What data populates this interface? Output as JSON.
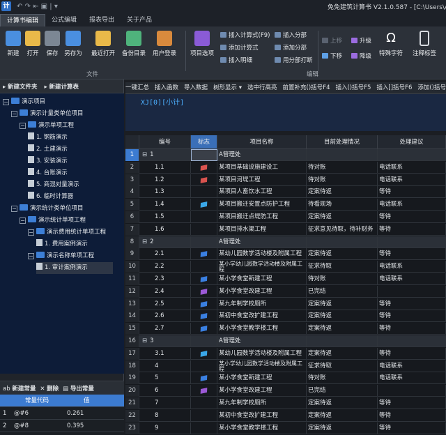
{
  "titlebar": {
    "app_icon": "计",
    "quick_access": "↶ ↷ ⇤ ▣ | ▾",
    "title": "免免建筑计算书 V2.1.0.587 - [C:\\Users\\Adr"
  },
  "tabs": [
    "计算书编辑",
    "公式编辑",
    "报表导出",
    "关于产品"
  ],
  "ribbon": {
    "file_buttons": [
      {
        "label": "新建",
        "color": "#4a8fe0"
      },
      {
        "label": "打开",
        "color": "#e9b949"
      },
      {
        "label": "保存",
        "color": "#7c8794"
      },
      {
        "label": "另存为",
        "color": "#4a8fe0"
      },
      {
        "label": "最近打开",
        "color": "#e9b949"
      },
      {
        "label": "备份目录",
        "color": "#4fb37c"
      },
      {
        "label": "用户登录",
        "color": "#d98a3d"
      }
    ],
    "file_group_label": "文件",
    "project_button": {
      "label": "项目选项",
      "color": "#8a5bd6"
    },
    "insert_col1": [
      "插入计算式(F9)",
      "添加计算式",
      "插入明细"
    ],
    "insert_col2": [
      "插入分部",
      "添加分部",
      "用分部打断"
    ],
    "move_col": [
      "上移",
      "下移"
    ],
    "level_col": [
      "升级",
      "降级"
    ],
    "special_char": {
      "label": "特殊字符",
      "glyph": "Ω"
    },
    "annotation": {
      "label": "注释标签"
    },
    "edit_group_label": "编辑"
  },
  "left": {
    "toolbar": [
      "新建文件夹",
      "新建计算表"
    ],
    "tree": [
      {
        "level": 0,
        "type": "folder",
        "label": "演示项目"
      },
      {
        "level": 1,
        "type": "folder",
        "label": "演示计量类单位项目"
      },
      {
        "level": 2,
        "type": "folder",
        "label": "演示单项工程"
      },
      {
        "level": 3,
        "type": "doc",
        "label": "1. 钢筋演示"
      },
      {
        "level": 3,
        "type": "doc",
        "label": "2. 土建演示"
      },
      {
        "level": 3,
        "type": "doc",
        "label": "3. 安装演示"
      },
      {
        "level": 3,
        "type": "doc",
        "label": "4. 台账演示"
      },
      {
        "level": 3,
        "type": "doc",
        "label": "5. 商混对量演示"
      },
      {
        "level": 3,
        "type": "doc",
        "label": "6. 临时计算器"
      },
      {
        "level": 1,
        "type": "folder",
        "label": "演示统计类单位项目"
      },
      {
        "level": 2,
        "type": "folder",
        "label": "演示统计单项工程"
      },
      {
        "level": 3,
        "type": "folder",
        "label": "演示费用统计单项工程"
      },
      {
        "level": 4,
        "type": "doc",
        "label": "1. 费用案例演示"
      },
      {
        "level": 3,
        "type": "folder",
        "label": "演示名称单项工程"
      },
      {
        "level": 4,
        "type": "doc",
        "label": "1. 审计案例演示",
        "selected": true
      }
    ],
    "const_toolbar": [
      "新建常量",
      "删除",
      "导出常量"
    ],
    "const_headers": [
      "常量代码",
      "值"
    ],
    "const_rows": [
      {
        "n": "1",
        "code": "@#6",
        "value": "0.261"
      },
      {
        "n": "2",
        "code": "@#8",
        "value": "0.395"
      }
    ]
  },
  "right": {
    "toolbar": [
      "一键汇总",
      "插入函数",
      "导入数据",
      "树形显示 ▾",
      "选中行高亮",
      "前置补充()括号F4",
      "插入()括号F5",
      "插入[]括号F6",
      "添加()括号F"
    ],
    "formula": "XJ[0][小计]",
    "headers": [
      "",
      "编号",
      "标志",
      "项目名称",
      "目前处理情况",
      "处理建议"
    ],
    "rows": [
      {
        "rn": "1",
        "group": true,
        "code": "1",
        "name": "A管理处",
        "status": "",
        "suggest": "",
        "flag": "",
        "selected": true
      },
      {
        "rn": "2",
        "code": "1.1",
        "name": "某项目基础设施建设工",
        "status": "待对账",
        "suggest": "电话联系",
        "flag": "#d9534f"
      },
      {
        "rn": "3",
        "code": "1.2",
        "name": "某项目河堤工程",
        "status": "待对账",
        "suggest": "电话联系",
        "flag": "#d9534f"
      },
      {
        "rn": "4",
        "code": "1.3",
        "name": "某项目人畜饮水工程",
        "status": "定案待返",
        "suggest": "等待",
        "flag": ""
      },
      {
        "rn": "5",
        "code": "1.4",
        "name": "某项目搬迁安置点防护工程",
        "status": "待看现场",
        "suggest": "电话联系",
        "flag": "#3aa7e8"
      },
      {
        "rn": "6",
        "code": "1.5",
        "name": "某项目搬迁点堤防工程",
        "status": "定案待返",
        "suggest": "等待",
        "flag": ""
      },
      {
        "rn": "7",
        "code": "1.6",
        "name": "某项目排水渠工程",
        "status": "征求意见待取，待补财务",
        "suggest": "等待",
        "flag": ""
      },
      {
        "rn": "8",
        "group": true,
        "code": "2",
        "name": "A管理处",
        "status": "",
        "suggest": "",
        "flag": ""
      },
      {
        "rn": "9",
        "code": "2.1",
        "name": "某幼儿园数学活动楼及附属工程",
        "status": "定案待返",
        "suggest": "等待",
        "flag": "#3a7fe0"
      },
      {
        "rn": "10",
        "code": "2.2",
        "name": "某小学幼儿园数学活动楼及附属工程",
        "status": "征求待取",
        "suggest": "电话联系",
        "flag": "",
        "two_line": true
      },
      {
        "rn": "11",
        "code": "2.3",
        "name": "某小学食堂新建工程",
        "status": "待对账",
        "suggest": "电话联系",
        "flag": "#3a7fe0"
      },
      {
        "rn": "12",
        "code": "2.4",
        "name": "某小学食堂改建工程",
        "status": "已完结",
        "suggest": "",
        "flag": "#9b59d6"
      },
      {
        "rn": "13",
        "code": "2.5",
        "name": "某九年制学校厕所",
        "status": "定案待返",
        "suggest": "等待",
        "flag": "#3a7fe0"
      },
      {
        "rn": "14",
        "code": "2.6",
        "name": "某初中食堂改扩建工程",
        "status": "定案待返",
        "suggest": "等待",
        "flag": "#3a7fe0"
      },
      {
        "rn": "15",
        "code": "2.7",
        "name": "某小学食堂教学楼工程",
        "status": "定案待返",
        "suggest": "等待",
        "flag": "#3a7fe0"
      },
      {
        "rn": "16",
        "group": true,
        "code": "3",
        "name": "A管理处",
        "status": "",
        "suggest": "",
        "flag": ""
      },
      {
        "rn": "17",
        "code": "3.1",
        "name": "某幼儿园数学活动楼及附属工程",
        "status": "定案待返",
        "suggest": "等待",
        "flag": "#3aa7e8"
      },
      {
        "rn": "18",
        "code": "4",
        "name": "某小学幼儿园数学活动楼及附属工程",
        "status": "征求待取",
        "suggest": "电话联系",
        "flag": "",
        "two_line": true
      },
      {
        "rn": "19",
        "code": "5",
        "name": "某小学食堂新建工程",
        "status": "待对账",
        "suggest": "电话联系",
        "flag": "#3a7fe0"
      },
      {
        "rn": "20",
        "code": "6",
        "name": "某小学食堂改建工程",
        "status": "已完结",
        "suggest": "",
        "flag": "#9b59d6"
      },
      {
        "rn": "21",
        "code": "7",
        "name": "某九年制学校厕所",
        "status": "定案待返",
        "suggest": "等待",
        "flag": ""
      },
      {
        "rn": "22",
        "code": "8",
        "name": "某初中食堂改扩建工程",
        "status": "定案待返",
        "suggest": "等待",
        "flag": ""
      },
      {
        "rn": "23",
        "code": "9",
        "name": "某小学食堂教学楼工程",
        "status": "定案待返",
        "suggest": "等待",
        "flag": ""
      }
    ]
  }
}
